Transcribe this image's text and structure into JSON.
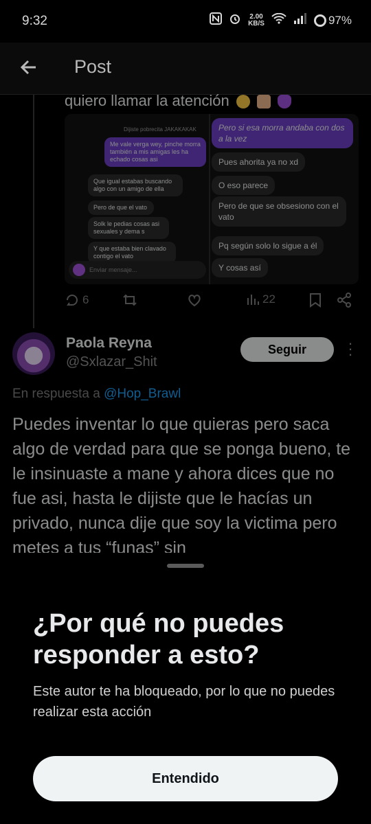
{
  "status_bar": {
    "time": "9:32",
    "speed_value": "2.00",
    "speed_unit": "KB/S",
    "battery": "97%"
  },
  "header": {
    "title": "Post"
  },
  "previous_tweet": {
    "text": "quiero llamar la atención",
    "chat": {
      "top_label": "Dijiste pobrecita JAKAKAKAK",
      "left_purple": "Me vale verga wey, pinche morra también a mis amigas les ha echado cosas asi",
      "left_grey_1": "Que igual estabas buscando algo con un amigo de ella",
      "left_grey_2": "Pero de que el vato",
      "left_grey_3": "Solk le pedias cosas asi sexuales y dema s",
      "left_grey_4": "Y que estaba bien clavado contigo el vato",
      "input_placeholder": "Enviar mensaje...",
      "right_purple": "Pero si esa morra andaba con dos a la vez",
      "right_1": "Pues ahorita ya no xd",
      "right_2": "O eso parece",
      "right_3": "Pero de que se obsesiono con el vato",
      "right_4": "Pq según solo lo sigue a él",
      "right_5": "Y cosas así"
    },
    "replies": "6",
    "views": "22"
  },
  "post": {
    "author_name": "Paola Reyna",
    "author_handle": "@Sxlazar_Shit",
    "follow_label": "Seguir",
    "reply_prefix": "En respuesta a",
    "reply_handle": "@Hop_Brawl",
    "body": "Puedes inventar lo que quieras pero saca algo de verdad para que se ponga bueno, te le insinuaste a mane y ahora dices que no fue asi, hasta le dijiste que le hacías un privado, nunca dije que soy la victima pero metes a tus “funas” sin"
  },
  "sheet": {
    "title": "¿Por qué no puedes responder a esto?",
    "message": "Este autor te ha bloqueado, por lo que no puedes realizar esta acción",
    "button_label": "Entendido"
  },
  "colors": {
    "accent_link": "#1d9bf0",
    "purple_bubble": "#6b3fc4"
  }
}
